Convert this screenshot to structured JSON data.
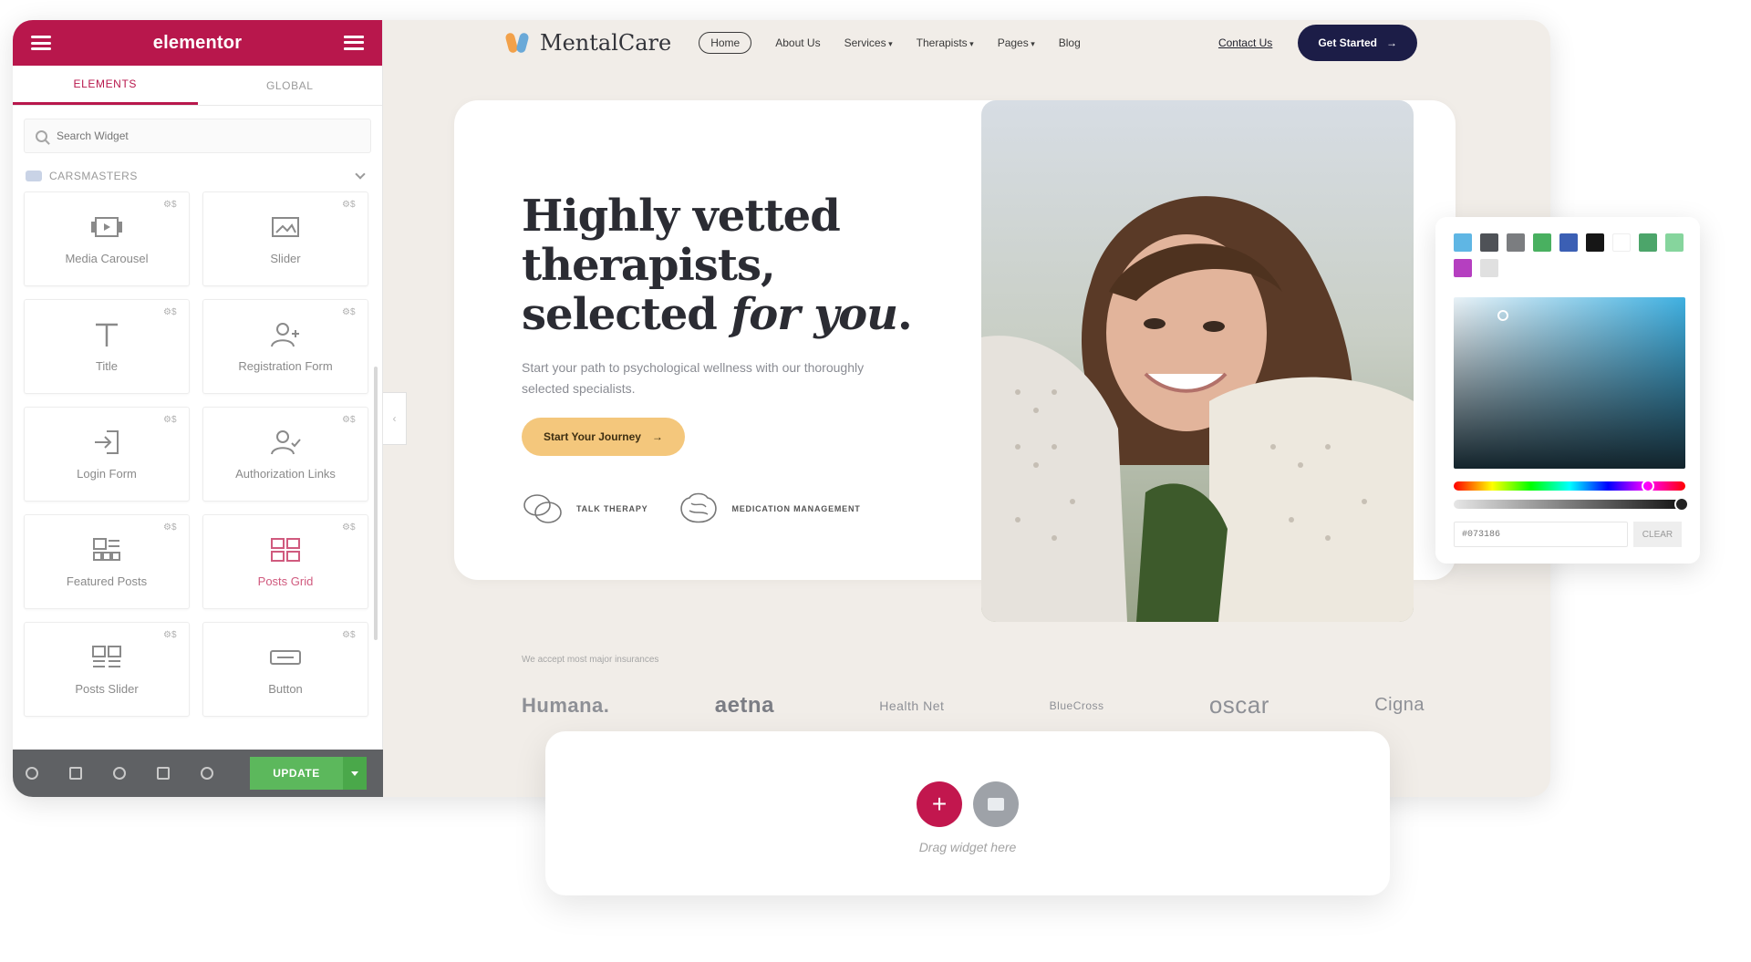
{
  "panel": {
    "logo": "elementor",
    "tabs": [
      "ELEMENTS",
      "GLOBAL"
    ],
    "search_placeholder": "Search Widget",
    "category": "CARSMASTERS",
    "widgets": [
      {
        "label": "Media Carousel",
        "icon": "media-carousel-icon"
      },
      {
        "label": "Slider",
        "icon": "slider-icon"
      },
      {
        "label": "Title",
        "icon": "title-icon"
      },
      {
        "label": "Registration Form",
        "icon": "registration-form-icon"
      },
      {
        "label": "Login Form",
        "icon": "login-form-icon"
      },
      {
        "label": "Authorization Links",
        "icon": "authorization-links-icon"
      },
      {
        "label": "Featured Posts",
        "icon": "featured-posts-icon"
      },
      {
        "label": "Posts Grid",
        "icon": "posts-grid-icon"
      },
      {
        "label": "Posts Slider",
        "icon": "posts-slider-icon"
      },
      {
        "label": "Button",
        "icon": "button-icon"
      }
    ],
    "update_label": "UPDATE"
  },
  "site": {
    "brand": "MentalCare",
    "nav": [
      "Home",
      "About Us",
      "Services",
      "Therapists",
      "Pages",
      "Blog"
    ],
    "contact": "Contact Us",
    "get_started": "Get Started",
    "hero_line1": "Highly vetted",
    "hero_line2": "therapists,",
    "hero_line3_plain": "selected ",
    "hero_line3_em": "for you",
    "hero_period": ".",
    "hero_sub": "Start your path to psychological wellness with our thoroughly selected specialists.",
    "cta": "Start Your Journey",
    "features": [
      "TALK THERAPY",
      "MEDICATION MANAGEMENT"
    ],
    "trusted": "We accept most major insurances",
    "logos": [
      "Humana.",
      "aetna",
      "Health Net",
      "BlueCross",
      "oscar",
      "Cigna"
    ]
  },
  "dropzone": {
    "add": "+",
    "hint": "Drag widget here"
  },
  "picker": {
    "swatches": [
      "#5fb6e4",
      "#4f5257",
      "#7b7d80",
      "#49b060",
      "#3b5fb4",
      "#161616",
      "#ffffff",
      "#4ca56a",
      "#86d59d",
      "#b53fc0",
      "#e0e0e0"
    ],
    "hex": "#073186",
    "clear": "CLEAR"
  }
}
